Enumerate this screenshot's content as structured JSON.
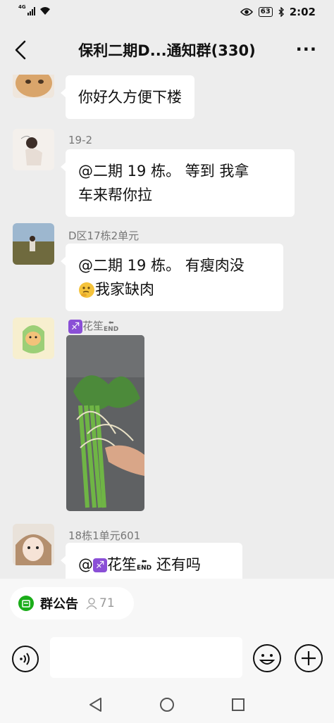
{
  "status_bar": {
    "network": "4G",
    "battery": "63",
    "time": "2:02",
    "icons": [
      "signal-icon",
      "wifi-icon",
      "eye-icon",
      "battery-icon",
      "bluetooth-icon"
    ]
  },
  "header": {
    "title": "保利二期D...通知群(330)",
    "back_icon": "chevron-left-icon",
    "more_label": "···"
  },
  "messages": [
    {
      "sender": "",
      "lines": [
        "你好久方便下楼"
      ],
      "avatar": "cat-avatar"
    },
    {
      "sender": "19-2",
      "lines": [
        "@二期 19 栋。 等到 我拿",
        "车来帮你拉"
      ],
      "avatar": "girl-sketch-avatar"
    },
    {
      "sender": "D区17栋2单元",
      "lines": [
        "@二期 19 栋。 有瘦肉没",
        "我家缺肉"
      ],
      "avatar": "field-photo-avatar",
      "emoji": "thinking-face"
    },
    {
      "sender": "花笙",
      "image": "vegetable-bundle-photo",
      "avatar": "dinosaur-dog-avatar"
    },
    {
      "sender": "18栋1单元601",
      "lines_parts": {
        "prefix": "@",
        "name": "花笙",
        "suffix": " 还有吗"
      },
      "avatar": "girl-hat-avatar"
    }
  ],
  "end_arrow_label": "END",
  "sagittarius_symbol": "♐",
  "notice": {
    "label": "群公告",
    "member_count": "71"
  },
  "input": {
    "placeholder": "",
    "value": ""
  },
  "colors": {
    "background": "#ededed",
    "bubble": "#ffffff",
    "accent": "#1aad19",
    "sender_text": "#777777"
  }
}
